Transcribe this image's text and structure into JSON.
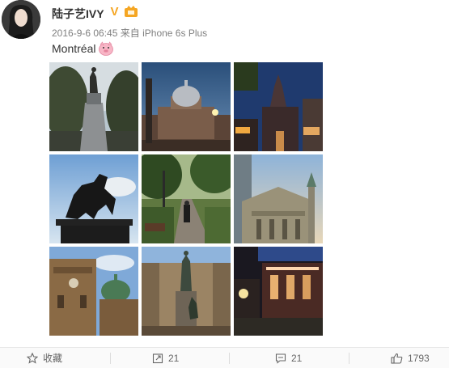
{
  "user": {
    "name": "陆子艺IVY",
    "verified_badge": "V"
  },
  "post": {
    "timestamp": "2016-9-6 06:45",
    "source_prefix": "来自",
    "source_device": "iPhone 6s Plus",
    "text": "Montréal",
    "emoji": "pig-face"
  },
  "photos": [
    {
      "name": "statue-monument"
    },
    {
      "name": "domed-market-dusk"
    },
    {
      "name": "basilica-night"
    },
    {
      "name": "horse-statue-silhouette"
    },
    {
      "name": "park-path-woman"
    },
    {
      "name": "cathedral-facade"
    },
    {
      "name": "dome-church-clock"
    },
    {
      "name": "statue-plaza"
    },
    {
      "name": "lit-storefront-night"
    }
  ],
  "actions": {
    "favorite_label": "收藏",
    "repost_count": "21",
    "comment_count": "21",
    "like_count": "1793"
  },
  "colors": {
    "accent": "#f5a623",
    "text": "#333333",
    "meta": "#808080"
  }
}
